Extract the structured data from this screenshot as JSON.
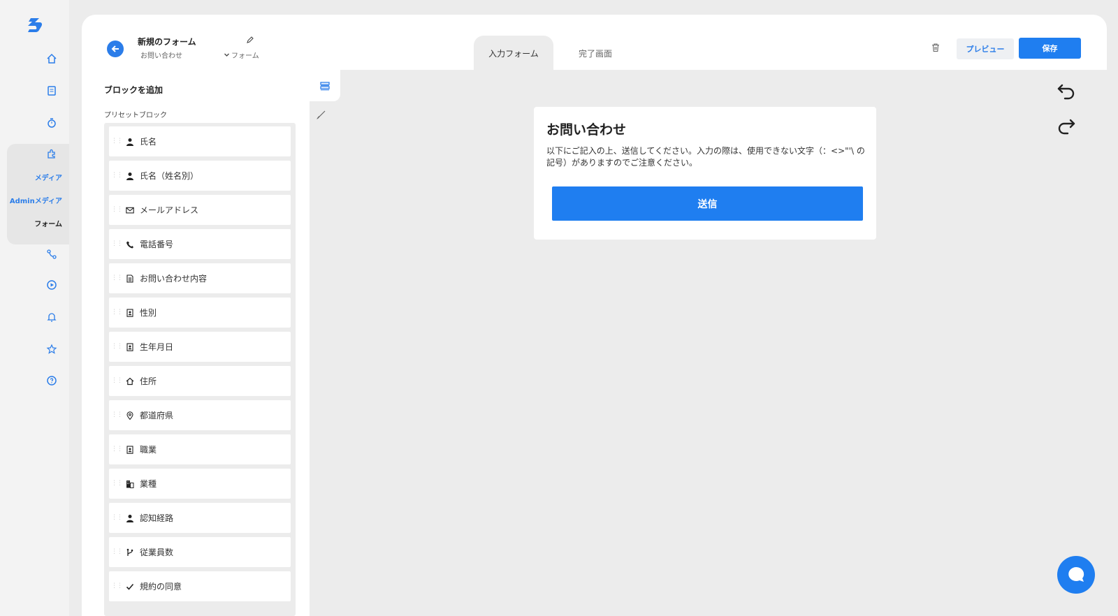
{
  "nav": {
    "sub_media": "メディア",
    "sub_admin_media": "Adminメディア",
    "sub_form": "フォーム"
  },
  "header": {
    "title": "新規のフォーム",
    "subtitle": "お問い合わせ",
    "type_label": "フォーム",
    "tabs": [
      {
        "label": "入力フォーム",
        "active": true
      },
      {
        "label": "完了画面",
        "active": false
      }
    ],
    "preview_label": "プレビュー",
    "save_label": "保存"
  },
  "panel": {
    "title": "ブロックを追加",
    "subtitle": "プリセットブロック",
    "items": [
      {
        "label": "氏名",
        "icon": "person-icon"
      },
      {
        "label": "氏名（姓名別）",
        "icon": "person-icon"
      },
      {
        "label": "メールアドレス",
        "icon": "mail-icon"
      },
      {
        "label": "電話番号",
        "icon": "phone-icon"
      },
      {
        "label": "お問い合わせ内容",
        "icon": "document-icon"
      },
      {
        "label": "性別",
        "icon": "id-badge-icon"
      },
      {
        "label": "生年月日",
        "icon": "id-badge-icon"
      },
      {
        "label": "住所",
        "icon": "home-icon"
      },
      {
        "label": "都道府県",
        "icon": "location-pin-icon"
      },
      {
        "label": "職業",
        "icon": "id-badge-icon"
      },
      {
        "label": "業種",
        "icon": "building-icon"
      },
      {
        "label": "認知経路",
        "icon": "person-icon"
      },
      {
        "label": "従業員数",
        "icon": "branch-icon"
      },
      {
        "label": "規約の同意",
        "icon": "check-icon"
      }
    ]
  },
  "preview": {
    "title": "お問い合わせ",
    "description": "以下にご記入の上、送信してください。入力の際は、使用できない文字（：<>\"'\\ の記号）がありますのでご注意ください。",
    "submit_label": "送信"
  },
  "colors": {
    "accent": "#1f7ef0",
    "canvas": "#ececec"
  }
}
